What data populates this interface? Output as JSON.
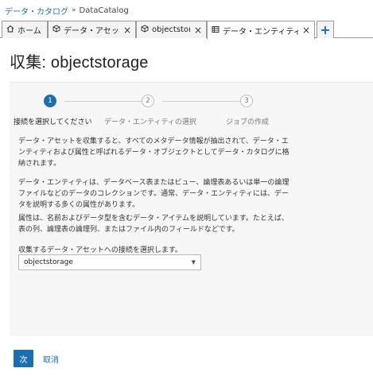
{
  "breadcrumb": {
    "parent": "データ・カタログ",
    "separator": "»",
    "current": "DataCatalog"
  },
  "tabs": [
    {
      "icon": "home-icon",
      "label": "ホーム",
      "closable": false,
      "active": false
    },
    {
      "icon": "data-asset-icon",
      "label": "データ・アセット",
      "closable": true,
      "active": false
    },
    {
      "icon": "data-asset-icon",
      "label": "objectstor...",
      "closable": true,
      "active": false
    },
    {
      "icon": "data-entity-icon",
      "label": "データ・エンティティ...",
      "closable": true,
      "active": true
    }
  ],
  "add_tab_label": "+",
  "page": {
    "title": "収集: objectstorage"
  },
  "wizard": {
    "steps": [
      {
        "number": "1",
        "label": "接続を選択してください",
        "state": "current"
      },
      {
        "number": "2",
        "label": "データ・エンティティの選択",
        "state": "pending"
      },
      {
        "number": "3",
        "label": "ジョブの作成",
        "state": "pending"
      }
    ],
    "paragraphs": [
      "データ・アセットを収集すると、すべてのメタデータ情報が抽出されて、データ・エンティティおよび属性と呼ばれるデータ・オブジェクトとしてデータ・カタログに格納されます。",
      "データ・エンティティは、データベース表またはビュー、論理表あるいは単一の論理ファイルなどのデータのコレクションです。通常、データ・エンティティには、データを説明する多くの属性があります。",
      "属性は、名前およびデータ型を含むデータ・アイテムを説明しています。たとえば、表の列、論理表の論理列、またはファイル内のフィールドなどです。"
    ],
    "connection_label": "収集するデータ・アセットへの接続を選択します。",
    "connection_value": "objectstorage"
  },
  "footer": {
    "next_label": "次",
    "cancel_label": "取消"
  },
  "colors": {
    "accent": "#1a6fb0",
    "panel_bg": "#f7f7f7"
  }
}
